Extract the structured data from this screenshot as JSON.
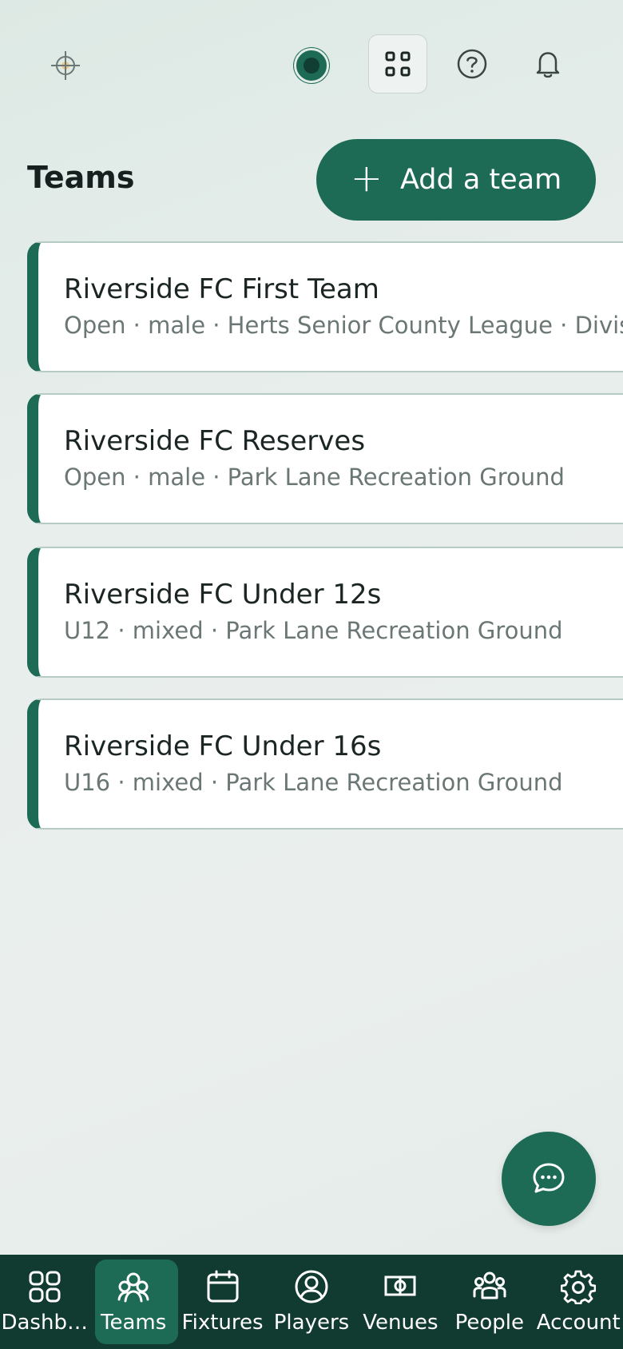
{
  "header": {
    "logo_icon": "crosshair-sun-icon",
    "status_icon": "status-dot",
    "apps_icon": "grid-icon",
    "help_icon": "help-circle-icon",
    "notifications_icon": "bell-icon"
  },
  "page": {
    "title": "Teams",
    "add_button_label": "Add a team",
    "add_button_icon": "plus-icon"
  },
  "teams": [
    {
      "name": "Riverside FC First Team",
      "meta": "Open · male · Herts Senior County League · Division One"
    },
    {
      "name": "Riverside FC Reserves",
      "meta": "Open · male · Park Lane Recreation Ground"
    },
    {
      "name": "Riverside FC Under 12s",
      "meta": "U12 · mixed · Park Lane Recreation Ground"
    },
    {
      "name": "Riverside FC Under 16s",
      "meta": "U16 · mixed · Park Lane Recreation Ground"
    }
  ],
  "chat_icon": "chat-bubble-icon",
  "nav": {
    "items": [
      {
        "label": "Dashb…",
        "icon": "dashboard-icon"
      },
      {
        "label": "Teams",
        "icon": "teams-icon"
      },
      {
        "label": "Fixtures",
        "icon": "calendar-icon"
      },
      {
        "label": "Players",
        "icon": "player-icon"
      },
      {
        "label": "Venues",
        "icon": "pitch-icon"
      },
      {
        "label": "People",
        "icon": "people-icon"
      },
      {
        "label": "Account",
        "icon": "gear-icon"
      }
    ],
    "active": "Teams"
  },
  "colors": {
    "primary": "#1e6b55",
    "nav_bg": "#113a30",
    "card_border": "#b7cbc5"
  }
}
